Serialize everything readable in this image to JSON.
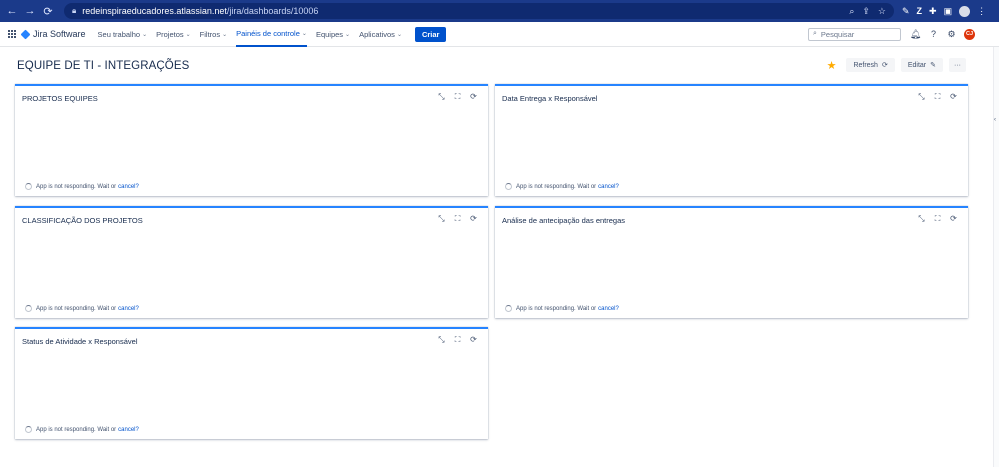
{
  "browser": {
    "url_host": "redeinspiraeducadores.atlassian.net",
    "url_path": "/jira/dashboards/10006"
  },
  "header": {
    "product": "Jira Software",
    "menu": [
      {
        "label": "Seu trabalho",
        "active": false
      },
      {
        "label": "Projetos",
        "active": false
      },
      {
        "label": "Filtros",
        "active": false
      },
      {
        "label": "Painéis de controle",
        "active": true
      },
      {
        "label": "Equipes",
        "active": false
      },
      {
        "label": "Aplicativos",
        "active": false
      }
    ],
    "create_label": "Criar",
    "search_placeholder": "Pesquisar",
    "user_initials": "CJ"
  },
  "dashboard": {
    "title": "EQUIPE DE TI - INTEGRAÇÕES",
    "refresh_label": "Refresh",
    "edit_label": "Editar",
    "more_label": "···"
  },
  "gadgets": [
    {
      "title": "PROJETOS EQUIPES"
    },
    {
      "title": "Data Entrega x Responsável"
    },
    {
      "title": "CLASSIFICAÇÃO DOS PROJETOS"
    },
    {
      "title": "Análise de antecipação das entregas"
    },
    {
      "title": "Status de Atividade x Responsável"
    }
  ],
  "status": {
    "message": "App is not responding. Wait or",
    "cancel": "cancel?"
  },
  "colors": {
    "brand": "#0052cc",
    "gadget_border": "#2684ff",
    "star": "#ffab00",
    "browser_bar": "#1b3a8a"
  }
}
